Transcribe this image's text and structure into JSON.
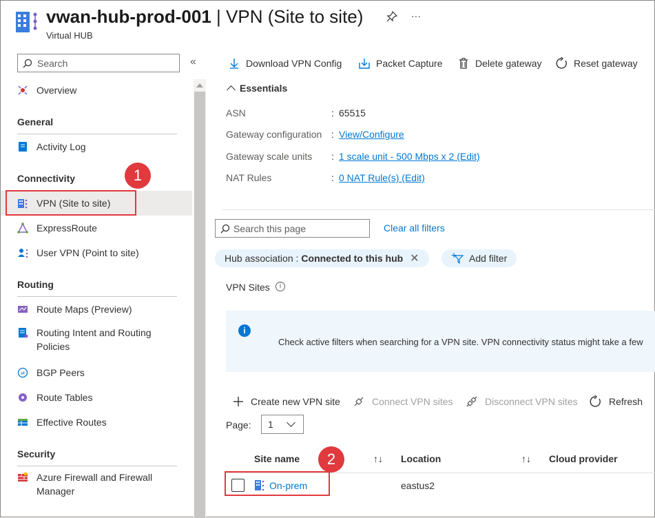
{
  "header": {
    "title_resource": "vwan-hub-prod-001",
    "title_sep": "|",
    "title_page": "VPN (Site to site)",
    "subtitle": "Virtual HUB",
    "pin_icon": "pin-icon",
    "more_glyph": "···"
  },
  "sidebar": {
    "search_placeholder": "Search",
    "collapse_glyph": "«",
    "overview": "Overview",
    "sections": {
      "general": "General",
      "connectivity": "Connectivity",
      "routing": "Routing",
      "security": "Security"
    },
    "items": {
      "activity_log": "Activity Log",
      "vpn_site_to_site": "VPN (Site to site)",
      "expressroute": "ExpressRoute",
      "user_vpn": "User VPN (Point to site)",
      "route_maps": "Route Maps (Preview)",
      "routing_intent": "Routing Intent and Routing Policies",
      "bgp_peers": "BGP Peers",
      "route_tables": "Route Tables",
      "effective_routes": "Effective Routes",
      "azure_firewall": "Azure Firewall and Firewall Manager"
    }
  },
  "toolbar": {
    "download": "Download VPN Config",
    "packet_capture": "Packet Capture",
    "delete": "Delete gateway",
    "reset": "Reset gateway"
  },
  "essentials": {
    "title": "Essentials",
    "rows": [
      {
        "label": "ASN",
        "value": "65515"
      },
      {
        "label": "Gateway configuration",
        "value": "View/Configure"
      },
      {
        "label": "Gateway scale units",
        "value": "1 scale unit - 500 Mbps x 2 (Edit)"
      },
      {
        "label": "NAT Rules",
        "value": "0 NAT Rule(s) (Edit)"
      }
    ]
  },
  "filters": {
    "search_placeholder": "Search this page",
    "clear": "Clear all filters",
    "pill_key": "Hub association : ",
    "pill_value": "Connected to this hub",
    "add_filter": "Add filter"
  },
  "vpn_sites": {
    "label": "VPN Sites",
    "info_text": "Check active filters when searching for a VPN site. VPN connectivity status might take a few"
  },
  "commands": {
    "create": "Create new VPN site",
    "connect": "Connect VPN sites",
    "disconnect": "Disconnect VPN sites",
    "refresh": "Refresh"
  },
  "paging": {
    "label": "Page:",
    "value": "1"
  },
  "table": {
    "columns": [
      "Site name",
      "Location",
      "Cloud provider"
    ],
    "rows": [
      {
        "site_name": "On-prem",
        "location": "eastus2",
        "cloud_provider": ""
      }
    ]
  },
  "callouts": {
    "one": "1",
    "two": "2"
  },
  "colors": {
    "accent": "#0078d4",
    "callout": "#e0393e",
    "selected_nav": "#edebe9",
    "info_bg": "#eff6fc"
  }
}
